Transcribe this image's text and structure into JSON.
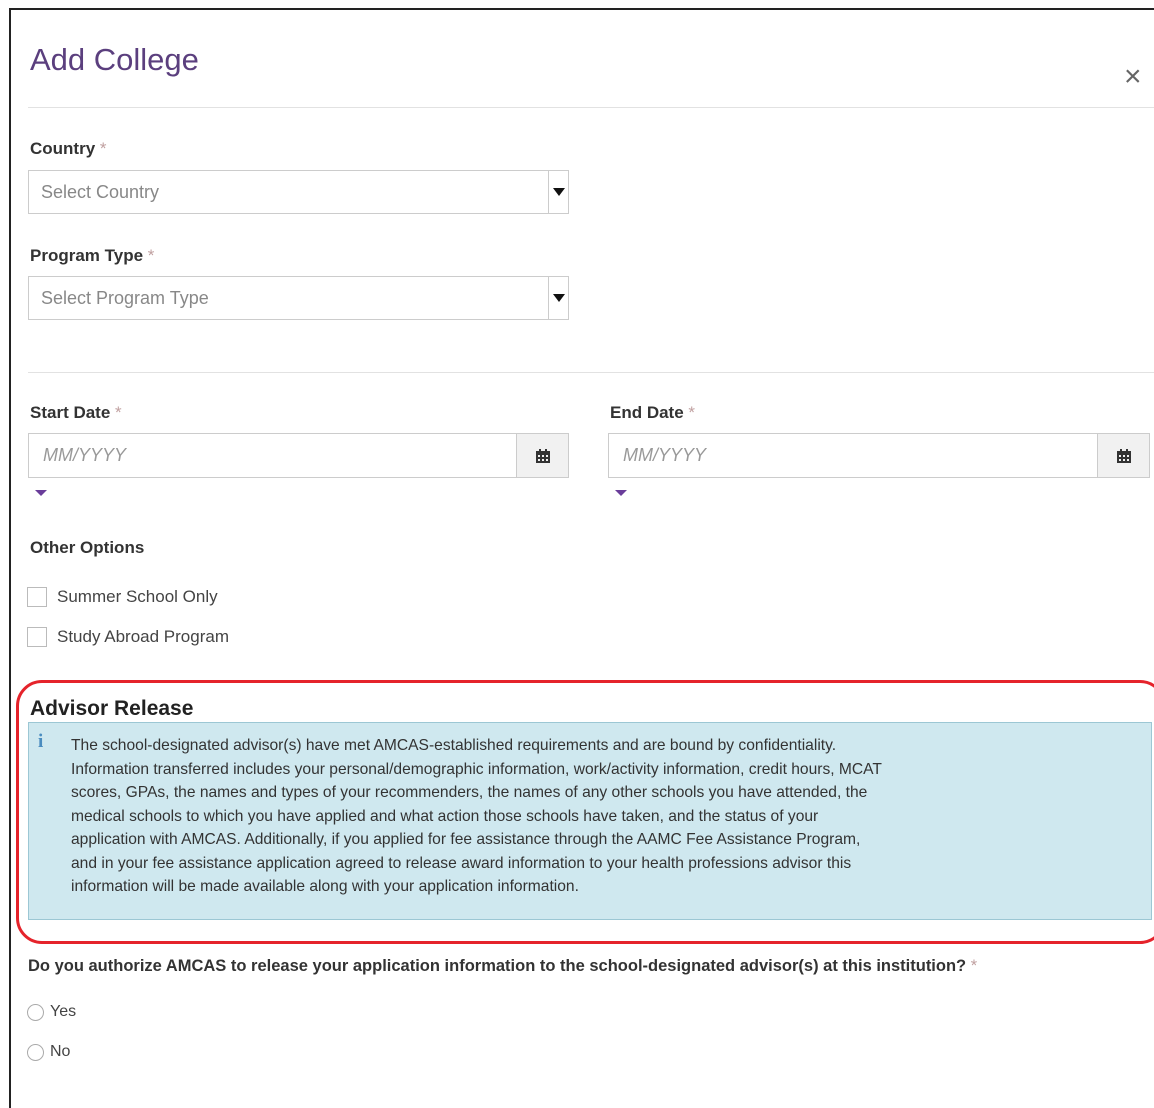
{
  "modal": {
    "title": "Add College",
    "close_symbol": "×"
  },
  "fields": {
    "country": {
      "label": "Country",
      "required": "*",
      "placeholder": "Select Country"
    },
    "program_type": {
      "label": "Program Type",
      "required": "*",
      "placeholder": "Select Program Type"
    },
    "start_date": {
      "label": "Start Date",
      "required": "*",
      "placeholder": "MM/YYYY"
    },
    "end_date": {
      "label": "End Date",
      "required": "*",
      "placeholder": "MM/YYYY"
    }
  },
  "other_options": {
    "label": "Other Options",
    "items": [
      {
        "label": "Summer School Only",
        "checked": false
      },
      {
        "label": "Study Abroad Program",
        "checked": false
      }
    ]
  },
  "advisor_release": {
    "title": "Advisor Release",
    "info_icon": "i",
    "text_lines": [
      "The school-designated advisor(s) have met AMCAS-established requirements and are bound by confidentiality.",
      "Information transferred includes your personal/demographic information, work/activity information, credit hours, MCAT",
      "scores, GPAs, the names and types of your recommenders, the names of any other schools you have attended, the",
      "medical schools to which you have applied and what action those schools have taken, and the status of your",
      "application with AMCAS. Additionally, if you applied for fee assistance through the AAMC Fee Assistance Program,",
      "and in your fee assistance application agreed to release award information to your health professions advisor this",
      "information will be made available along with your application information."
    ],
    "highlight_color": "#e5232b",
    "box_color": "#cfe8ef"
  },
  "authorization": {
    "question": "Do you authorize AMCAS to release your application information to the school-designated advisor(s) at this institution?",
    "required": "*",
    "options": [
      "Yes",
      "No"
    ]
  },
  "colors": {
    "title": "#5b3f7e",
    "accent_caret": "#6a3d9a"
  },
  "icons": {
    "close": "close-icon",
    "calendar": "calendar-icon",
    "dropdown": "chevron-down-icon",
    "info": "info-icon"
  }
}
